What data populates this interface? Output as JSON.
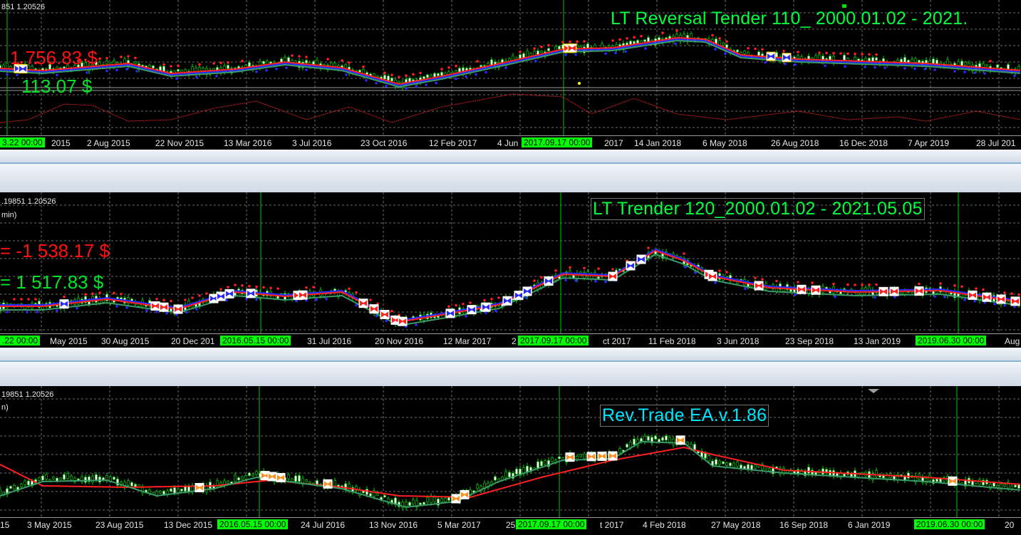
{
  "panels": [
    {
      "symbol": "851 1.20526",
      "ea_title": "LT Reversal Tender 110_ 2000.01.02 - 2021.",
      "pl_red": "1 756.83 $",
      "pl_green": "113.07 $",
      "sub_label": "",
      "axis_labels": [
        "2015",
        "2 Aug 2015",
        "22 Nov 2015",
        "13 Mar 2016",
        "3 Jul 2016",
        "23 Oct 2016",
        "12 Feb 2017",
        "4 Jun",
        "2017",
        "14 Jan 2018",
        "6 May 2018",
        "26 Aug 2018",
        "16 Dec 2018",
        "7 Apr 2019",
        "28 Jul 201"
      ],
      "axis_tags": [
        "3.22 00:00",
        "2017.09.17 00:00"
      ]
    },
    {
      "symbol": ".19851 1.20526",
      "ea_title": "LT Trender 120_2000.01.02 - 2021.05.05",
      "pl_red": "= -1 538.17 $",
      "pl_green": "= 1 517.83 $",
      "sub_label": "min)",
      "axis_labels": [
        "May 2015",
        "30 Aug 2015",
        "20 Dec 201",
        "31 Jul 2016",
        "20 Nov 2016",
        "12 Mar 2017",
        "2",
        "ct 2017",
        "11 Feb 2018",
        "3 Jun 2018",
        "23 Sep 2018",
        "13 Jan 2019",
        "Aug"
      ],
      "axis_tags": [
        ".22 00:00",
        "2016.05.15 00:00",
        "2017.09.17 00:00",
        "2019.06.30 00:00"
      ]
    },
    {
      "symbol": "19851 1.20526",
      "ea_title": "Rev.Trade EA.v.1.86",
      "pl_red": "",
      "pl_green": "",
      "sub_label": "n)",
      "axis_labels": [
        "15",
        "3 May 2015",
        "23 Aug 2015",
        "13 Dec 2015",
        "24 Jul 2016",
        "13 Nov 2016",
        "5 Mar 2017",
        "25",
        "t 2017",
        "4 Feb 2018",
        "27 May 2018",
        "16 Sep 2018",
        "6 Jan 2019",
        "20"
      ],
      "axis_tags": [
        "2016.05.15 00:00",
        "2017.09.17 00:00",
        "2019.06.30 00:00"
      ]
    }
  ],
  "colors": {
    "price": "#00dd00",
    "ma_fast": "#ff2020",
    "ma_slow": "#3a9a6a",
    "ma_blue": "#2a2aff",
    "grid": "#6e6e6e",
    "vline": "#00c800",
    "oscillator": "#d02020"
  }
}
